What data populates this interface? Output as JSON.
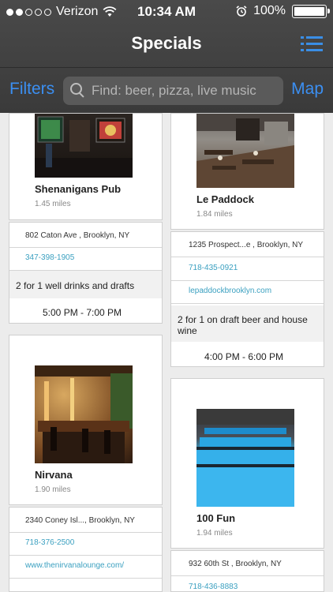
{
  "status": {
    "carrier": "Verizon",
    "time": "10:34 AM",
    "battery": "100%"
  },
  "nav": {
    "title": "Specials",
    "menu_icon": "list-menu-icon"
  },
  "search": {
    "filters_label": "Filters",
    "placeholder": "Find: beer, pizza, live music",
    "map_label": "Map"
  },
  "venues": [
    {
      "name": "Shenanigans Pub",
      "distance": "1.45 miles",
      "address": "802 Caton Ave , Brooklyn, NY",
      "phone": "347-398-1905",
      "special": "2 for 1 well drinks and drafts",
      "hours": "5:00 PM -  7:00 PM"
    },
    {
      "name": "Le Paddock",
      "distance": "1.84 miles",
      "address": "1235 Prospect...e , Brooklyn, NY",
      "phone": "718-435-0921",
      "website": "lepaddockbrooklyn.com",
      "special": "2 for 1 on draft beer and house wine",
      "hours": "4:00 PM -  6:00 PM"
    },
    {
      "name": "Nirvana",
      "distance": "1.90 miles",
      "address": "2340 Coney Isl..., Brooklyn, NY",
      "phone": "718-376-2500",
      "website": "www.thenirvanalounge.com/"
    },
    {
      "name": "100 Fun",
      "distance": "1.94 miles",
      "address": "932 60th St , Brooklyn, NY",
      "phone": "718-436-8883"
    }
  ]
}
